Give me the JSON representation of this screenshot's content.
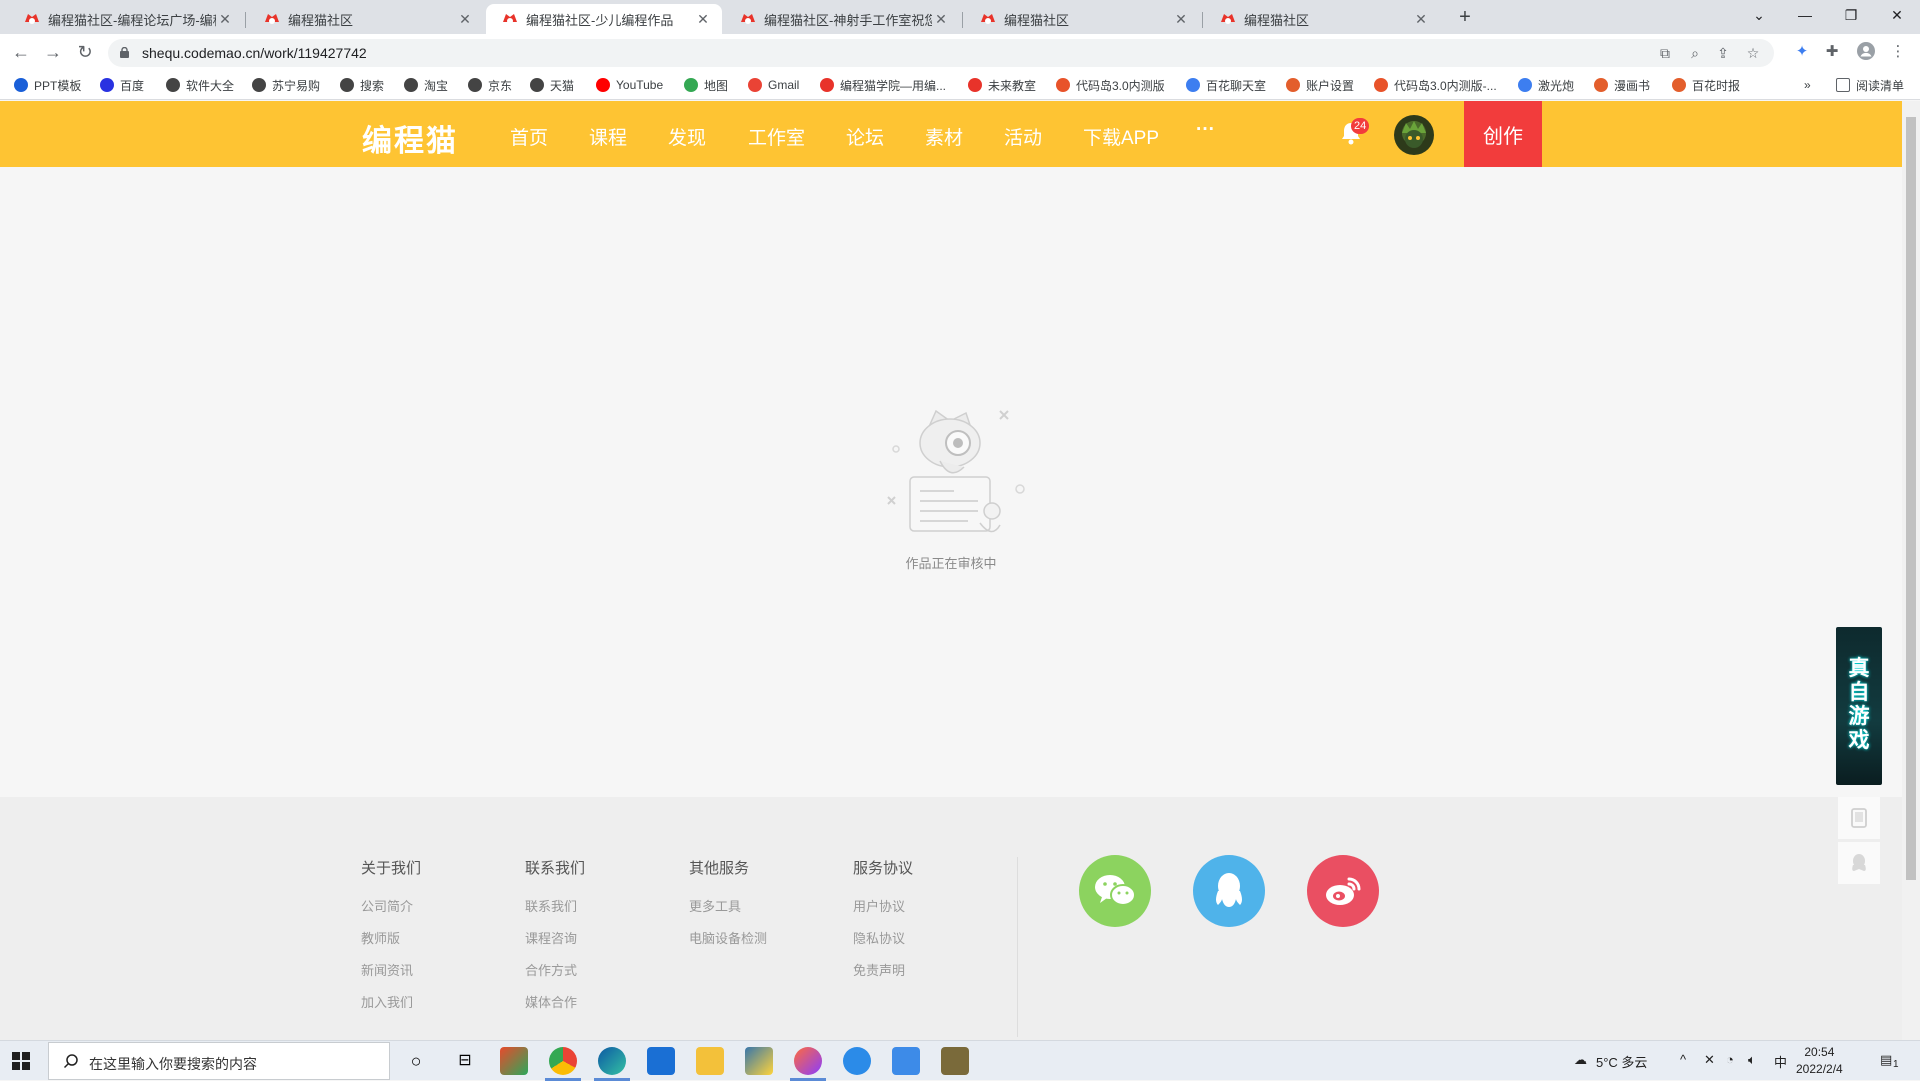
{
  "browser": {
    "tabs": [
      {
        "title": "编程猫社区-编程论坛广场-编程学"
      },
      {
        "title": "编程猫社区"
      },
      {
        "title": "编程猫社区-少儿编程作品"
      },
      {
        "title": "编程猫社区-神射手工作室祝您虎"
      },
      {
        "title": "编程猫社区"
      },
      {
        "title": "编程猫社区"
      }
    ],
    "active_tab": 2,
    "url": "shequ.codemao.cn/work/119427742",
    "bookmarks": [
      {
        "label": "PPT模板",
        "color": "#1a5fd8"
      },
      {
        "label": "百度",
        "color": "#2932e1"
      },
      {
        "label": "软件大全",
        "color": "#444444"
      },
      {
        "label": "苏宁易购",
        "color": "#444444"
      },
      {
        "label": "搜索",
        "color": "#444444"
      },
      {
        "label": "淘宝",
        "color": "#444444"
      },
      {
        "label": "京东",
        "color": "#444444"
      },
      {
        "label": "天猫",
        "color": "#444444"
      },
      {
        "label": "YouTube",
        "color": "#ff0000"
      },
      {
        "label": "地图",
        "color": "#34a853"
      },
      {
        "label": "Gmail",
        "color": "#ea4335"
      },
      {
        "label": "编程猫学院—用编...",
        "color": "#e8332a"
      },
      {
        "label": "未来教室",
        "color": "#e8332a"
      },
      {
        "label": "代码岛3.0内测版",
        "color": "#e8532a"
      },
      {
        "label": "百花聊天室",
        "color": "#3d7ef0"
      },
      {
        "label": "账户设置",
        "color": "#e35e2c"
      },
      {
        "label": "代码岛3.0内测版-...",
        "color": "#e8532a"
      },
      {
        "label": "激光炮",
        "color": "#3d7ef0"
      },
      {
        "label": "漫画书",
        "color": "#e35e2c"
      },
      {
        "label": "百花时报",
        "color": "#e35e2c"
      }
    ],
    "reading_list": "阅读清单"
  },
  "site": {
    "logo": "编程猫",
    "nav": [
      "首页",
      "课程",
      "发现",
      "工作室",
      "论坛",
      "素材",
      "活动",
      "下载APP",
      "···"
    ],
    "notification_count": "24",
    "create_label": "创作",
    "brand_color": "#fec433",
    "accent_color": "#f23c3c"
  },
  "main": {
    "status_text": "作品正在审核中"
  },
  "footer": {
    "columns": [
      {
        "title": "关于我们",
        "links": [
          "公司简介",
          "教师版",
          "新闻资讯",
          "加入我们"
        ]
      },
      {
        "title": "联系我们",
        "links": [
          "联系我们",
          "课程咨询",
          "合作方式",
          "媒体合作"
        ]
      },
      {
        "title": "其他服务",
        "links": [
          "更多工具",
          "电脑设备检测"
        ]
      },
      {
        "title": "服务协议",
        "links": [
          "用户协议",
          "隐私协议",
          "免责声明"
        ]
      }
    ],
    "social": [
      {
        "name": "wechat-icon",
        "color": "#8cd35f"
      },
      {
        "name": "qq-icon",
        "color": "#4fb3ea"
      },
      {
        "name": "weibo-icon",
        "color": "#ea4f62"
      }
    ]
  },
  "float": {
    "banner_text": [
      "真",
      "自",
      "游",
      "戏"
    ]
  },
  "taskbar": {
    "search_placeholder": "在这里输入你要搜索的内容",
    "weather": "5°C 多云",
    "ime": "中",
    "time": "20:54",
    "date": "2022/2/4",
    "notif_count": "1"
  }
}
